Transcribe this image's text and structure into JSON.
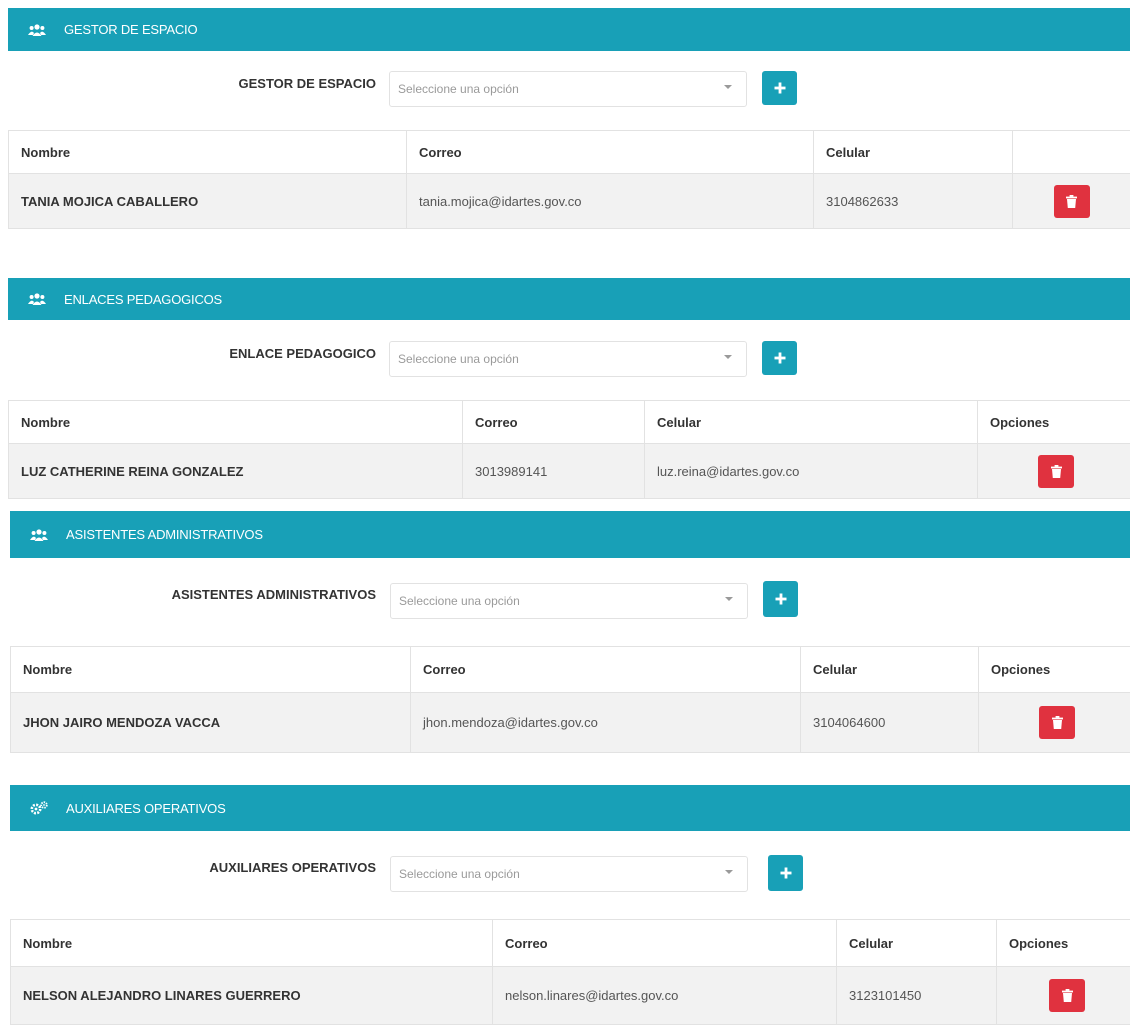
{
  "sections": [
    {
      "title": "GESTOR DE ESPACIO",
      "icon": "users-icon",
      "field_label": "GESTOR DE ESPACIO",
      "placeholder": "Seleccione una opción",
      "headers": [
        "Nombre",
        "Correo",
        "Celular",
        ""
      ],
      "row": {
        "nombre": "TANIA MOJICA CABALLERO",
        "col2": "tania.mojica@idartes.gov.co",
        "col3": "3104862633"
      }
    },
    {
      "title": "ENLACES PEDAGOGICOS",
      "icon": "users-icon",
      "field_label": "ENLACE PEDAGOGICO",
      "placeholder": "Seleccione una opción",
      "headers": [
        "Nombre",
        "Correo",
        "Celular",
        "Opciones"
      ],
      "row": {
        "nombre": "LUZ CATHERINE REINA GONZALEZ",
        "col2": "3013989141",
        "col3": "luz.reina@idartes.gov.co"
      }
    },
    {
      "title": "ASISTENTES ADMINISTRATIVOS",
      "icon": "users-icon",
      "field_label": "ASISTENTES ADMINISTRATIVOS",
      "placeholder": "Seleccione una opción",
      "headers": [
        "Nombre",
        "Correo",
        "Celular",
        "Opciones"
      ],
      "row": {
        "nombre": "JHON JAIRO MENDOZA VACCA",
        "col2": "jhon.mendoza@idartes.gov.co",
        "col3": "3104064600"
      }
    },
    {
      "title": "AUXILIARES OPERATIVOS",
      "icon": "cogs-icon",
      "field_label": "AUXILIARES OPERATIVOS",
      "placeholder": "Seleccione una opción",
      "headers": [
        "Nombre",
        "Correo",
        "Celular",
        "Opciones"
      ],
      "row": {
        "nombre": "NELSON ALEJANDRO LINARES GUERRERO",
        "col2": "nelson.linares@idartes.gov.co",
        "col3": "3123101450"
      }
    }
  ],
  "colors": {
    "header_bg": "#18a0b7",
    "delete_btn": "#e0323f",
    "row_bg": "#f2f2f2"
  },
  "icons": {
    "add": "plus-icon",
    "delete": "trash-icon"
  }
}
